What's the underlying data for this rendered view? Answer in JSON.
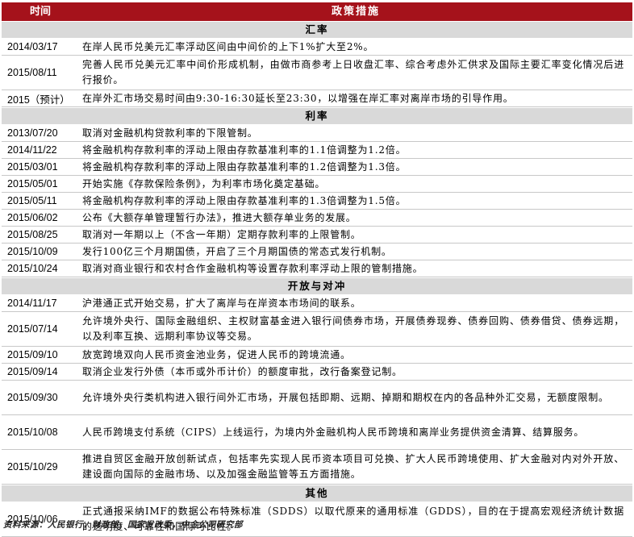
{
  "header": {
    "col_time": "时间",
    "col_policy": "政策措施"
  },
  "sections": [
    {
      "title": "汇率",
      "rows": [
        {
          "date": "2014/03/17",
          "text": "在岸人民币兑美元汇率浮动区间由中间价的上下1%扩大至2%。"
        },
        {
          "date": "2015/08/11",
          "text": "完善人民币兑美元汇率中间价形成机制，由做市商参考上日收盘汇率、综合考虑外汇供求及国际主要汇率变化情况后进行报价。"
        },
        {
          "date": "2015（预计）",
          "text": "在岸外汇市场交易时间由9:30-16:30延长至23:30，以增强在岸汇率对离岸市场的引导作用。"
        }
      ]
    },
    {
      "title": "利率",
      "rows": [
        {
          "date": "2013/07/20",
          "text": "取消对金融机构贷款利率的下限管制。"
        },
        {
          "date": "2014/11/22",
          "text": "将金融机构存款利率的浮动上限由存款基准利率的1.1倍调整为1.2倍。"
        },
        {
          "date": "2015/03/01",
          "text": "将金融机构存款利率的浮动上限由存款基准利率的1.2倍调整为1.3倍。"
        },
        {
          "date": "2015/05/01",
          "text": "开始实施《存款保险条例》，为利率市场化奠定基础。"
        },
        {
          "date": "2015/05/11",
          "text": "将金融机构存款利率的浮动上限由存款基准利率的1.3倍调整为1.5倍。"
        },
        {
          "date": "2015/06/02",
          "text": "公布《大额存单管理暂行办法》，推进大额存单业务的发展。"
        },
        {
          "date": "2015/08/25",
          "text": "取消对一年期以上（不含一年期）定期存款利率的上限管制。"
        },
        {
          "date": "2015/10/09",
          "text": "发行100亿三个月期国债，开启了三个月期国债的常态式发行机制。"
        },
        {
          "date": "2015/10/24",
          "text": "取消对商业银行和农村合作金融机构等设置存款利率浮动上限的管制措施。"
        }
      ]
    },
    {
      "title": "开放与对冲",
      "rows": [
        {
          "date": "2014/11/17",
          "text": "沪港通正式开始交易，扩大了离岸与在岸资本市场间的联系。"
        },
        {
          "date": "2015/07/14",
          "text": "允许境外央行、国际金融组织、主权财富基金进入银行间债券市场，开展债券现券、债券回购、债券借贷、债券远期，以及利率互换、远期利率协议等交易。"
        },
        {
          "date": "2015/09/10",
          "text": "放宽跨境双向人民币资金池业务，促进人民币的跨境流通。"
        },
        {
          "date": "2015/09/14",
          "text": "取消企业发行外债（本币或外币计价）的额度审批，改行备案登记制。"
        },
        {
          "date": "2015/09/30",
          "text": "允许境外央行类机构进入银行间外汇市场，开展包括即期、远期、掉期和期权在内的各品种外汇交易，无额度限制。"
        },
        {
          "date": "2015/10/08",
          "text": "人民币跨境支付系统（CIPS）上线运行，为境内外金融机构人民币跨境和离岸业务提供资金清算、结算服务。"
        },
        {
          "date": "2015/10/29",
          "text": "推进自贸区金融开放创新试点，包括率先实现人民币资本项目可兑换、扩大人民币跨境使用、扩大金融对内对外开放、建设面向国际的金融市场、以及加强金融监管等五方面措施。"
        }
      ]
    },
    {
      "title": "其他",
      "rows": [
        {
          "date": "2015/10/06",
          "text": "正式通报采纳IMF的数据公布特殊标准（SDDS）以取代原来的通用标准（GDDS），目的在于提高宏观经济统计数据的透明度、可靠性和国际可比性。"
        }
      ]
    }
  ],
  "source": "资料来源：人民银行，财政部，国家发改委，中金公司研究部"
}
